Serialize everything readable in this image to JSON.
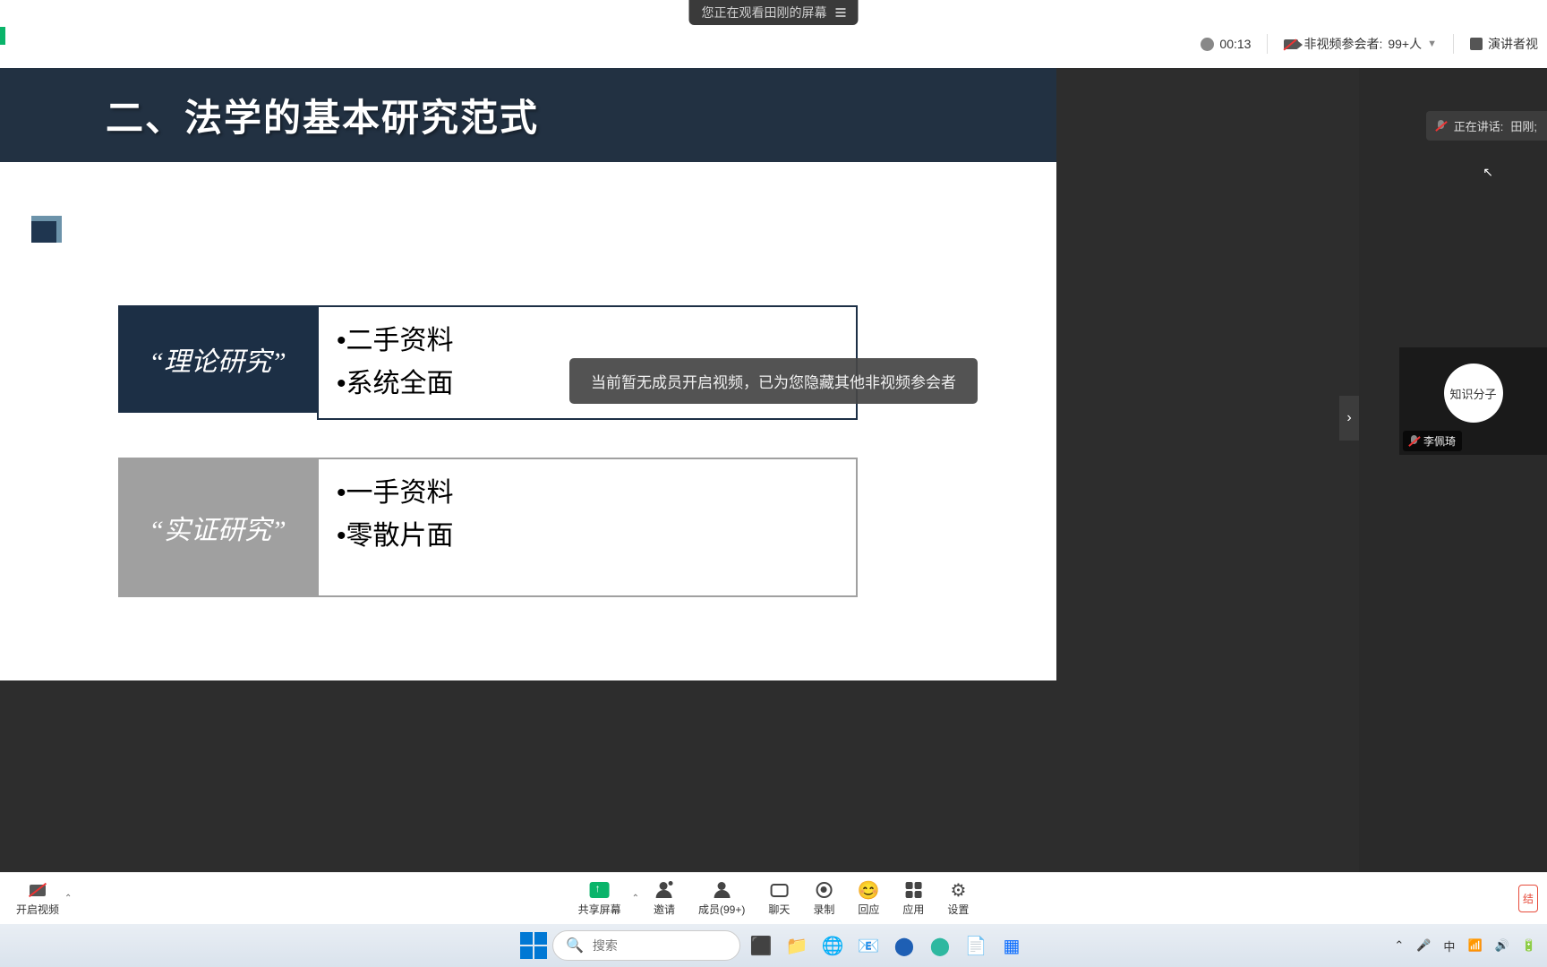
{
  "share_notice": "您正在观看田刚的屏幕",
  "info_bar": {
    "timer": "00:13",
    "participants_label": "非视频参会者:",
    "participants_count": "99+人",
    "view_mode": "演讲者视"
  },
  "slide": {
    "title": "二、法学的基本研究范式",
    "paradigm1": {
      "label": "“理论研究”",
      "b1": "•二手资料",
      "b2": "•系统全面"
    },
    "paradigm2": {
      "label": "“实证研究”",
      "b1": "•一手资料",
      "b2": "•零散片面"
    }
  },
  "toast": "当前暂无成员开启视频，已为您隐藏其他非视频参会者",
  "speaking": {
    "prefix": "正在讲话:",
    "name": "田刚;"
  },
  "participant_tile": {
    "avatar_text": "知识分子",
    "name": "李佩琦"
  },
  "controls": {
    "video": "开启视频",
    "share": "共享屏幕",
    "invite": "邀请",
    "members": "成员(99+)",
    "chat": "聊天",
    "record": "录制",
    "react": "回应",
    "apps": "应用",
    "settings": "设置"
  },
  "taskbar": {
    "search_placeholder": "搜索",
    "ime": "中"
  }
}
